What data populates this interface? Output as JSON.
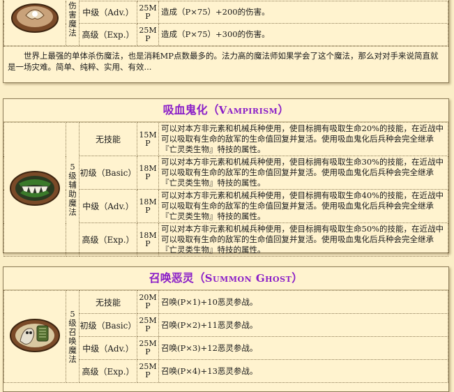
{
  "top_card": {
    "category": "伤害魔法",
    "rows": [
      {
        "level": "中级（Adv.）",
        "mp": "25MP",
        "mp_a": "25M",
        "mp_b": "P",
        "desc": "造成（P×75）+200的伤害。"
      },
      {
        "level": "高级（Exp.）",
        "mp": "25MP",
        "mp_a": "25M",
        "mp_b": "P",
        "desc": "造成（P×75）+300的伤害。"
      }
    ],
    "note": "世界上最强的单体杀伤魔法，也是消耗MP点数最多的。法力高的魔法师如果学会了这个魔法，那么对对手来说简直就是一场灾难。简单、纯粹、实用、有效..."
  },
  "vampirism": {
    "title_cn": "吸血鬼化（",
    "title_en": "Vampirism",
    "title_end": "）",
    "category": "5级辅助魔法",
    "icon": "vampire-fangs-icon",
    "rows": [
      {
        "level": "无技能",
        "mp_a": "15M",
        "mp_b": "P",
        "desc": "可以对本方非元素和机械兵种使用，使目标拥有吸取生命20%的技能，在近战中可以吸取有生命的敌军的生命值回复并复活。使用吸血鬼化后兵种会完全继承『亡灵类生物』特技的属性。"
      },
      {
        "level": "初级（Basic）",
        "mp_a": "18M",
        "mp_b": "P",
        "desc": "可以对本方非元素和机械兵种使用，使目标拥有吸取生命30%的技能，在近战中可以吸取有生命的敌军的生命值回复并复活。使用吸血鬼化后兵种会完全继承『亡灵类生物』特技的属性。"
      },
      {
        "level": "中级（Adv.）",
        "mp_a": "18M",
        "mp_b": "P",
        "desc": "可以对本方非元素和机械兵种使用，使目标拥有吸取生命40%的技能，在近战中可以吸取有生命的敌军的生命值回复并复活。使用吸血鬼化后兵种会完全继承『亡灵类生物』特技的属性。"
      },
      {
        "level": "高级（Exp.）",
        "mp_a": "18M",
        "mp_b": "P",
        "desc": "可以对本方非元素和机械兵种使用，使目标拥有吸取生命50%的技能，在近战中可以吸取有生命的敌军的生命值回复并复活。使用吸血鬼化后兵种会完全继承『亡灵类生物』特技的属性。"
      }
    ]
  },
  "summon_ghost": {
    "title_cn": "召唤恶灵（",
    "title_en": "Summon Ghost",
    "title_end": "）",
    "category": "5级召唤魔法",
    "icon": "ghost-summon-icon",
    "rows": [
      {
        "level": "无技能",
        "mp_a": "20M",
        "mp_b": "P",
        "desc": "召唤(P×1)+10恶灵参战。"
      },
      {
        "level": "初级（Basic）",
        "mp_a": "25M",
        "mp_b": "P",
        "desc": "召唤(P×2)+11恶灵参战。"
      },
      {
        "level": "中级（Adv.）",
        "mp_a": "25M",
        "mp_b": "P",
        "desc": "召唤(P×3)+12恶灵参战。"
      },
      {
        "level": "高级（Exp.）",
        "mp_a": "25M",
        "mp_b": "P",
        "desc": "召唤(P×4)+13恶灵参战。"
      }
    ]
  },
  "colors": {
    "title": "#8a1ec8",
    "background": "#fbeec7",
    "card": "#fff3cf"
  }
}
